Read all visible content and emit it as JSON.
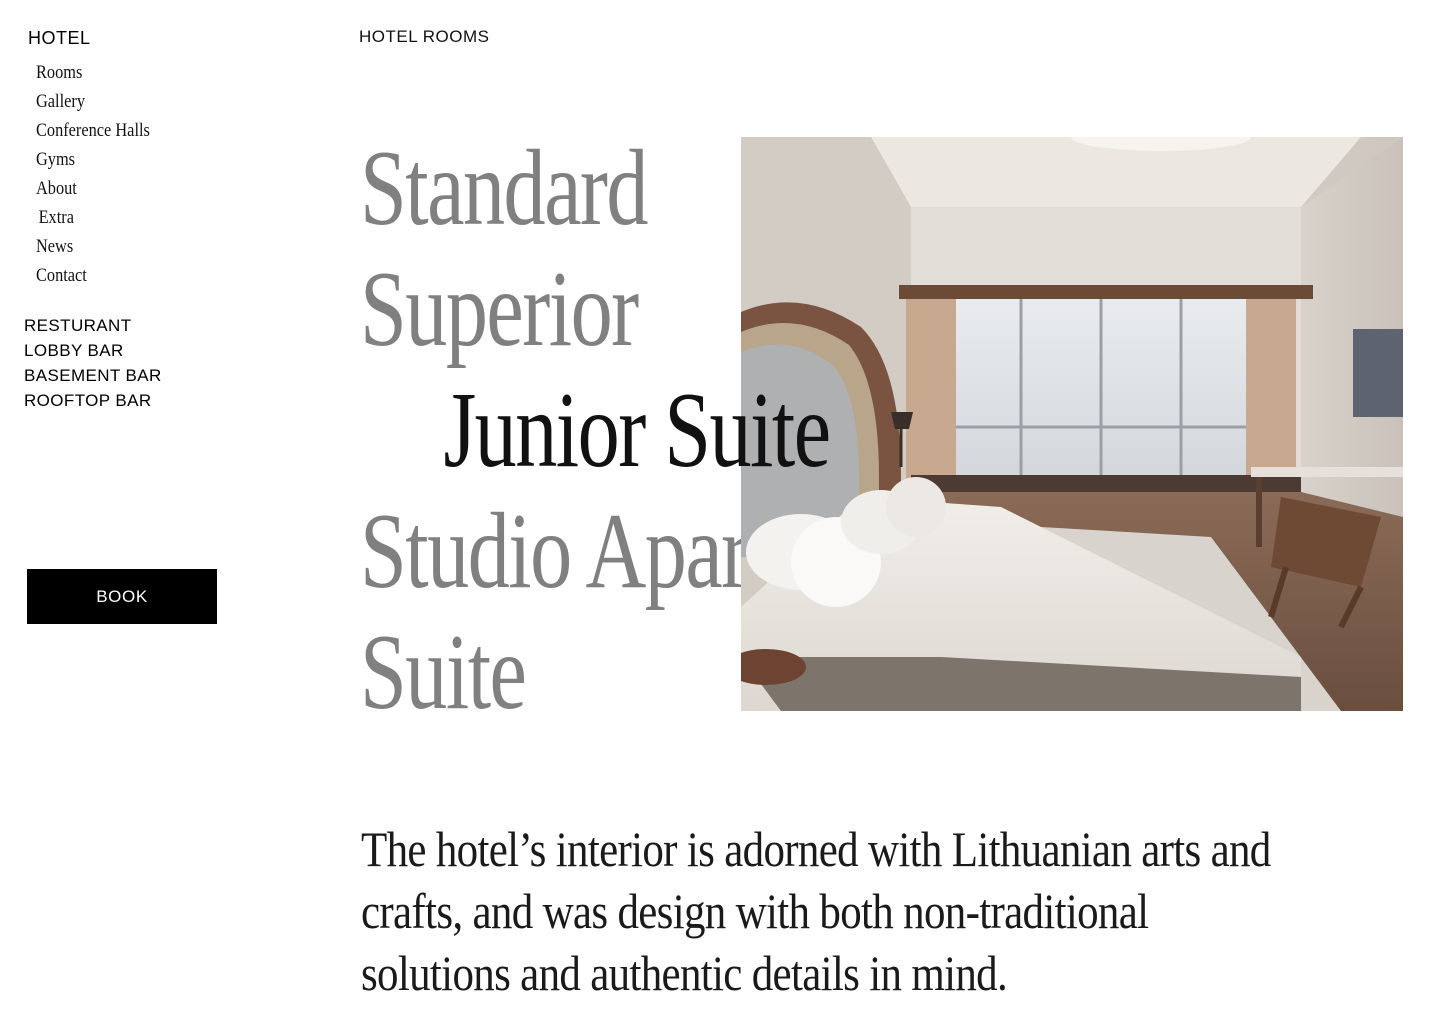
{
  "sidebar": {
    "brand": "HOTEL",
    "nav": [
      "Rooms",
      "Gallery",
      "Conference Halls",
      "Gyms",
      "About",
      "Extra",
      "News",
      "Contact"
    ],
    "venues": [
      "RESTURANT",
      "LOBBY BAR",
      "BASEMENT BAR",
      "ROOFTOP BAR"
    ],
    "book_label": "BOOK"
  },
  "main": {
    "section_label": "HOTEL ROOMS",
    "rooms": [
      "Standard",
      "Superior",
      "Junior Suite",
      "Studio Apartment",
      "Suite"
    ],
    "active_room": "Junior Suite",
    "description": "The hotel’s interior is adorned with Lithuanian arts and crafts, and was design with both non-traditional solutions and authentic details in mind."
  },
  "colors": {
    "background": "#ffffff",
    "text": "#111111",
    "muted_room": "#808080",
    "button_bg": "#000000",
    "button_text": "#ffffff"
  }
}
